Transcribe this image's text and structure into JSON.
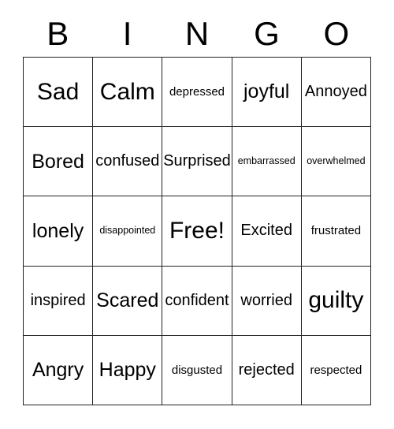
{
  "card": {
    "title": "BINGO",
    "header_letters": [
      "B",
      "I",
      "N",
      "G",
      "O"
    ],
    "grid_size": 5,
    "free_space_label": "Free!",
    "free_space_position": {
      "row": 3,
      "column": 3
    },
    "colors": {
      "background": "#ffffff",
      "text": "#000000",
      "grid_line": "#222222"
    },
    "rows": [
      {
        "index": 1,
        "cells": [
          {
            "label": "Sad",
            "size": "len-s"
          },
          {
            "label": "Calm",
            "size": "len-s"
          },
          {
            "label": "depressed",
            "size": "len-xl"
          },
          {
            "label": "joyful",
            "size": "len-m"
          },
          {
            "label": "Annoyed",
            "size": "len-l"
          }
        ]
      },
      {
        "index": 2,
        "cells": [
          {
            "label": "Bored",
            "size": "len-m"
          },
          {
            "label": "confused",
            "size": "len-l"
          },
          {
            "label": "Surprised",
            "size": "len-l"
          },
          {
            "label": "embarrassed",
            "size": "len-xxl"
          },
          {
            "label": "overwhelmed",
            "size": "len-xxl"
          }
        ]
      },
      {
        "index": 3,
        "cells": [
          {
            "label": "lonely",
            "size": "len-m"
          },
          {
            "label": "disappointed",
            "size": "len-xxl"
          },
          {
            "label": "Free!",
            "size": "len-s"
          },
          {
            "label": "Excited",
            "size": "len-l"
          },
          {
            "label": "frustrated",
            "size": "len-xl"
          }
        ]
      },
      {
        "index": 4,
        "cells": [
          {
            "label": "inspired",
            "size": "len-l"
          },
          {
            "label": "Scared",
            "size": "len-m"
          },
          {
            "label": "confident",
            "size": "len-l"
          },
          {
            "label": "worried",
            "size": "len-l"
          },
          {
            "label": "guilty",
            "size": "len-s"
          }
        ]
      },
      {
        "index": 5,
        "cells": [
          {
            "label": "Angry",
            "size": "len-m"
          },
          {
            "label": "Happy",
            "size": "len-m"
          },
          {
            "label": "disgusted",
            "size": "len-xl"
          },
          {
            "label": "rejected",
            "size": "len-l"
          },
          {
            "label": "respected",
            "size": "len-xl"
          }
        ]
      }
    ]
  }
}
